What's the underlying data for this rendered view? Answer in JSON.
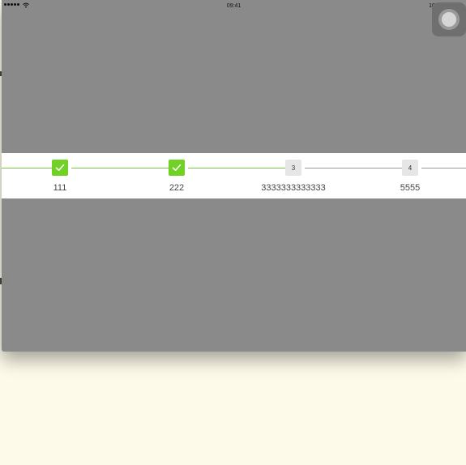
{
  "status_bar": {
    "time": "09:41",
    "battery_percent": "100%",
    "signal_icon": "signal-dots-icon",
    "wifi_icon": "wifi-icon",
    "battery_icon": "battery-icon"
  },
  "assistive_touch": {
    "icon": "assistive-touch-icon"
  },
  "colors": {
    "overlay": "#8a8a8a",
    "step_done": "#71d125",
    "step_todo": "#e6e6e6",
    "line_done": "#7ac943",
    "line_todo": "#9a9a9a",
    "background": "#fdfae9"
  },
  "steps": [
    {
      "label": "111",
      "state": "done",
      "marker": "",
      "icon": "check-icon"
    },
    {
      "label": "222",
      "state": "done",
      "marker": "",
      "icon": "check-icon"
    },
    {
      "label": "3333333333333",
      "state": "todo",
      "marker": "3",
      "icon": ""
    },
    {
      "label": "5555",
      "state": "todo",
      "marker": "4",
      "icon": ""
    }
  ]
}
